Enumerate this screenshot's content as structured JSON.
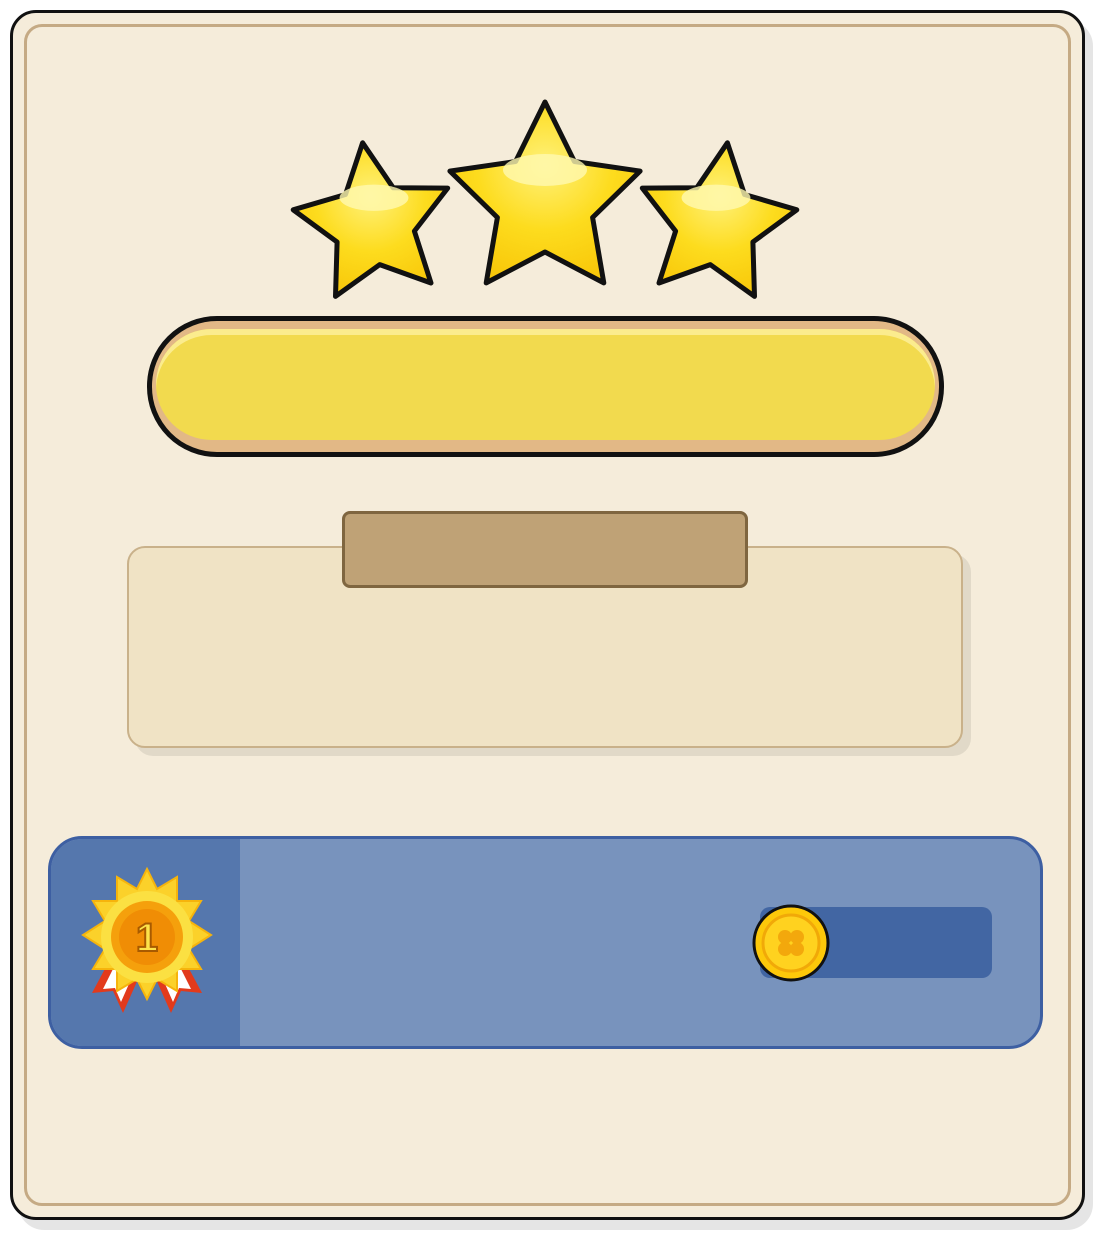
{
  "stars": {
    "earned": 3,
    "total": 3
  },
  "progress": {
    "fraction": 1.0,
    "label": ""
  },
  "info_panel": {
    "title": "",
    "text": ""
  },
  "reward_row": {
    "rank_number": "1",
    "player_name": "",
    "coin_amount": ""
  },
  "icons": [
    "star-icon",
    "medal-icon",
    "clover-coin-icon"
  ],
  "colors": {
    "panel_bg": "#f5ecda",
    "star_yellow": "#fdd617",
    "progress_fill": "#f2da4e",
    "tab_brown": "#bfa276",
    "reward_blue": "#7893bd",
    "rank_blue": "#5577ad",
    "coin_track": "#4266a3",
    "coin_gold": "#fdc80a"
  }
}
